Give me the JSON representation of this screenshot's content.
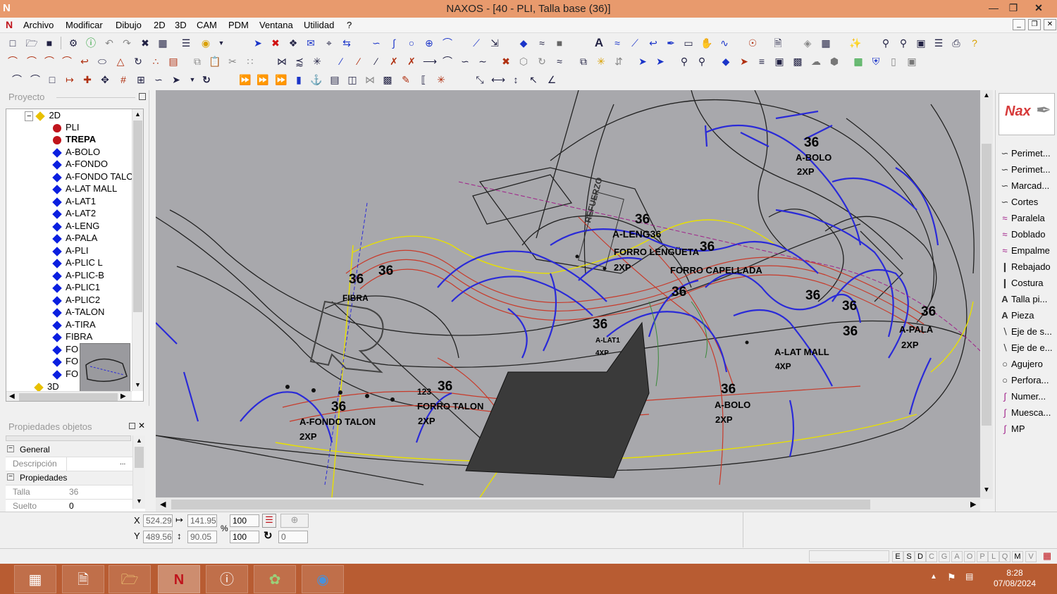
{
  "window": {
    "title": "NAXOS - [40 - PLI, Talla base (36)]",
    "app_icon": "N"
  },
  "menu": [
    "Archivo",
    "Modificar",
    "Dibujo",
    "2D",
    "3D",
    "CAM",
    "PDM",
    "Ventana",
    "Utilidad",
    "?"
  ],
  "project_panel": {
    "title": "Proyecto",
    "root": "2D",
    "items": [
      "PLI",
      "TREPA",
      "A-BOLO",
      "A-FONDO",
      "A-FONDO TALO",
      "A-LAT MALL",
      "A-LAT1",
      "A-LAT2",
      "A-LENG",
      "A-PALA",
      "A-PLI",
      "A-PLIC L",
      "A-PLIC-B",
      "A-PLIC1",
      "A-PLIC2",
      "A-TALON",
      "A-TIRA",
      "FIBRA",
      "FO",
      "FO",
      "FO"
    ],
    "root3d": "3D"
  },
  "props_panel": {
    "title": "Propiedades objetos",
    "group_general": "General",
    "descripcion_label": "Descripción",
    "group_props": "Propiedades",
    "talla_label": "Talla",
    "talla_value": "36",
    "suelto_label": "Suelto",
    "suelto_value": "0"
  },
  "canvas_labels": [
    {
      "t": "36"
    },
    {
      "t": "A-BOLO"
    },
    {
      "t": "2XP"
    },
    {
      "t": "36"
    },
    {
      "t": "A-LENG36"
    },
    {
      "t": "FORRO LENGÜETA"
    },
    {
      "t": "2XP"
    },
    {
      "t": "36"
    },
    {
      "t": "FORRO CAPELLADA"
    },
    {
      "t": "36"
    },
    {
      "t": "36"
    },
    {
      "t": "FIBRA"
    },
    {
      "t": "36"
    },
    {
      "t": "36"
    },
    {
      "t": "36"
    },
    {
      "t": "36"
    },
    {
      "t": "A-PALA"
    },
    {
      "t": "2XP"
    },
    {
      "t": "36"
    },
    {
      "t": "A-LAT MALL"
    },
    {
      "t": "4XP"
    },
    {
      "t": "36"
    },
    {
      "t": "A-LAT1"
    },
    {
      "t": "4XP"
    },
    {
      "t": "123"
    },
    {
      "t": "36"
    },
    {
      "t": "FORRO TALON"
    },
    {
      "t": "2XP"
    },
    {
      "t": "36"
    },
    {
      "t": "A-FONDO TALON"
    },
    {
      "t": "2XP"
    },
    {
      "t": "36"
    },
    {
      "t": "A-BOLO"
    },
    {
      "t": "2XP"
    },
    {
      "t": "REFUERZO"
    }
  ],
  "right_tools": [
    "Perimet...",
    "Perimet...",
    "Marcad...",
    "Cortes",
    "Paralela",
    "Doblado",
    "Empalme",
    "Rebajado",
    "Costura",
    "Talla pi...",
    "Pieza",
    "Eje de s...",
    "Eje de e...",
    "Agujero",
    "Perfora...",
    "Numer...",
    "Muesca...",
    "MP"
  ],
  "right_logo": "Nax",
  "coords": {
    "x_label": "X",
    "x": "524.29",
    "dx": "141.95",
    "sx": "100",
    "y_label": "Y",
    "y": "489.56",
    "dy": "90.05",
    "sy": "100",
    "rot": "0",
    "pct": "%"
  },
  "status_flags": [
    "E",
    "S",
    "D",
    "C",
    "G",
    "A",
    "O",
    "P",
    "L",
    "Q",
    "M",
    "V"
  ],
  "taskbar": {
    "time": "8:28",
    "date": "07/08/2024"
  },
  "colors": {
    "titlebar": "#e89a6d",
    "taskbar": "#b85c32",
    "canvas": "#a8a8ac",
    "piece_blue": "#2a2ad8",
    "piece_red": "#d03a2a",
    "piece_yellow": "#e8e000"
  }
}
